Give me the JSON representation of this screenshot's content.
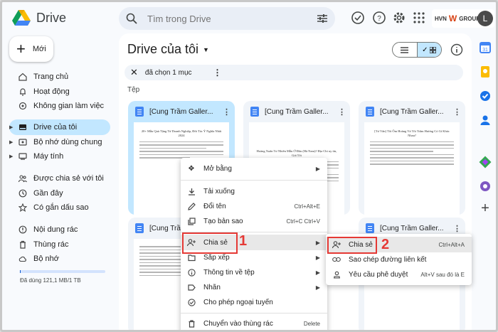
{
  "app": {
    "name": "Drive"
  },
  "search": {
    "placeholder": "Tìm trong Drive"
  },
  "brand": {
    "text": "HVN",
    "mark": "W",
    "suffix": "GROUP"
  },
  "user": {
    "initial": "L"
  },
  "sidebar": {
    "new_label": "Mới",
    "items": [
      {
        "label": "Trang chủ",
        "icon": "home-icon"
      },
      {
        "label": "Hoạt động",
        "icon": "bell-icon"
      },
      {
        "label": "Không gian làm việc",
        "icon": "workspace-icon"
      },
      {
        "label": "Drive của tôi",
        "icon": "drive-icon"
      },
      {
        "label": "Bộ nhớ dùng chung",
        "icon": "shared-drive-icon"
      },
      {
        "label": "Máy tính",
        "icon": "computer-icon"
      },
      {
        "label": "Được chia sẻ với tôi",
        "icon": "people-icon"
      },
      {
        "label": "Gần đây",
        "icon": "clock-icon"
      },
      {
        "label": "Có gắn dấu sao",
        "icon": "star-icon"
      },
      {
        "label": "Nội dung rác",
        "icon": "spam-icon"
      },
      {
        "label": "Thùng rác",
        "icon": "trash-icon"
      },
      {
        "label": "Bộ nhớ",
        "icon": "cloud-icon"
      }
    ],
    "storage_used_fraction": 0.01,
    "storage_text": "Đã dùng 121,1 MB/1 TB"
  },
  "main": {
    "title": "Drive của tôi",
    "selection_text": "đã chọn 1 mục",
    "section_label": "Tệp",
    "files": [
      {
        "name": "[Cung Trầm Galler..."
      },
      {
        "name": "[Cung Trầm Galler..."
      },
      {
        "name": "[Cung Trầm Galler..."
      },
      {
        "name": "[Cung Trầm Galler..."
      },
      {
        "name": "[Cung Trầm Galler..."
      },
      {
        "name": "[Cung Trầm Galler..."
      }
    ]
  },
  "context_menu": {
    "items": [
      {
        "label": "Mở bằng",
        "shortcut": "",
        "icon": "move-icon",
        "submenu": true
      },
      {
        "label": "Tải xuống",
        "shortcut": "",
        "icon": "download-icon"
      },
      {
        "label": "Đổi tên",
        "shortcut": "Ctrl+Alt+E",
        "icon": "pencil-icon"
      },
      {
        "label": "Tạo bản sao",
        "shortcut": "Ctrl+C Ctrl+V",
        "icon": "copy-icon"
      },
      {
        "label": "Chia sẻ",
        "shortcut": "",
        "icon": "person-add-icon",
        "submenu": true
      },
      {
        "label": "Sắp xếp",
        "shortcut": "",
        "icon": "folder-move-icon",
        "submenu": true
      },
      {
        "label": "Thông tin về tệp",
        "shortcut": "",
        "icon": "info-icon",
        "submenu": true
      },
      {
        "label": "Nhãn",
        "shortcut": "",
        "icon": "label-icon",
        "submenu": true
      },
      {
        "label": "Cho phép ngoại tuyến",
        "shortcut": "",
        "icon": "offline-icon"
      },
      {
        "label": "Chuyển vào thùng rác",
        "shortcut": "Delete",
        "icon": "trash-icon"
      }
    ]
  },
  "share_submenu": {
    "items": [
      {
        "label": "Chia sẻ",
        "shortcut": "Ctrl+Alt+A",
        "icon": "person-add-icon"
      },
      {
        "label": "Sao chép đường liên kết",
        "shortcut": "",
        "icon": "link-icon"
      },
      {
        "label": "Yêu cầu phê duyệt",
        "shortcut": "Alt+V sau đó là E",
        "icon": "approval-icon"
      }
    ]
  },
  "annotations": {
    "step1": "1",
    "step2": "2"
  },
  "thumb_text": {
    "t0": "20+ Mẫu Quà Tặng Từ Doanh Nghiệp, Đối Tác Ý Nghĩa Nhất 2024",
    "t1": "Hoàng Xuân Tư Nhiên Mẫu Ở Đâu (Hà Nam)? Địa Chỉ uy tín, Giá Tốt",
    "t2": "[Tư Vấn] Tôi Ốm Hoàng Và Tôi Trầm Hương Có Gì Khác Nhau?"
  },
  "colors": {
    "accent": "#0b57d0",
    "selected": "#c2e7ff",
    "annotation": "#e53935"
  }
}
